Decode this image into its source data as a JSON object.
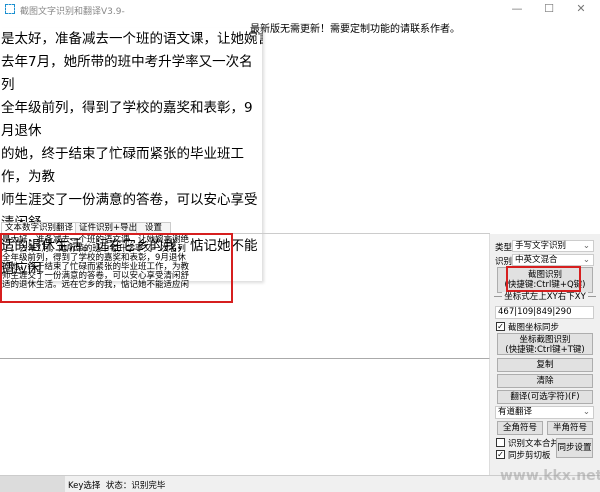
{
  "window": {
    "title": "截图文字识别和翻译V3.9-",
    "minimize": "—",
    "maximize": "☐",
    "close": "✕"
  },
  "notice": "最新版无需更新！需要定制功能的请联系作者。",
  "image_lines": [
    "是太好，准备减去一个班的语文课，让她婉言谢绝了。",
    "去年7月，她所带的班中考升学率又一次名列",
    "全年级前列，得到了学校的嘉奖和表彰，9月退休",
    "的她，终于结束了忙碌而紧张的毕业班工作，为教",
    "师生涯交了一份满意的答卷，可以安心享受清闲舒",
    "适的退休生活。远在它乡的我，惦记她不能适应闲"
  ],
  "tabs": [
    "文本数字识别翻译",
    "证件识别+导出",
    "设置"
  ],
  "ocr_lines": [
    "是太好，准备减去一个班的语文课，让她婉言谢绝",
    "了。去年7月，她所带的班中考升学率又一次名列",
    "全年级前列，得到了学校的嘉奖和表彰，9月退休",
    "的她，终于结束了忙碌而紧张的毕业班工作，为教",
    "师生涯交了一份满意的答卷，可以安心享受清闲舒",
    "适的退休生活。远在它乡的我，惦记她不能适应闲"
  ],
  "right": {
    "type_label": "类型",
    "type_value": "手写文字识别",
    "recog_label": "识别",
    "recog_value": "中英文混合",
    "capture_btn": [
      "截图识别",
      "(快捷键:Ctrl键+Q键)"
    ],
    "coord_label": "坐标式左上XY右下XY",
    "coord_value": "467|109|849|290",
    "sync_coord": "截图坐标同步",
    "coord_btn": [
      "坐标截图识别",
      "(快捷键:Ctrl键+T键)"
    ],
    "copy": "复制",
    "clear": "清除",
    "translate": "翻译(可选字符)(F)",
    "engine": "有道翻译",
    "fullwidth": "全角符号",
    "halfwidth": "半角符号",
    "merge": "识别文本合并",
    "clip": "同步剪切板",
    "sync_settings": "同步设置"
  },
  "status": {
    "key": "Key选择",
    "state": "状态：识别完毕"
  },
  "watermark": "www.kkx.net"
}
